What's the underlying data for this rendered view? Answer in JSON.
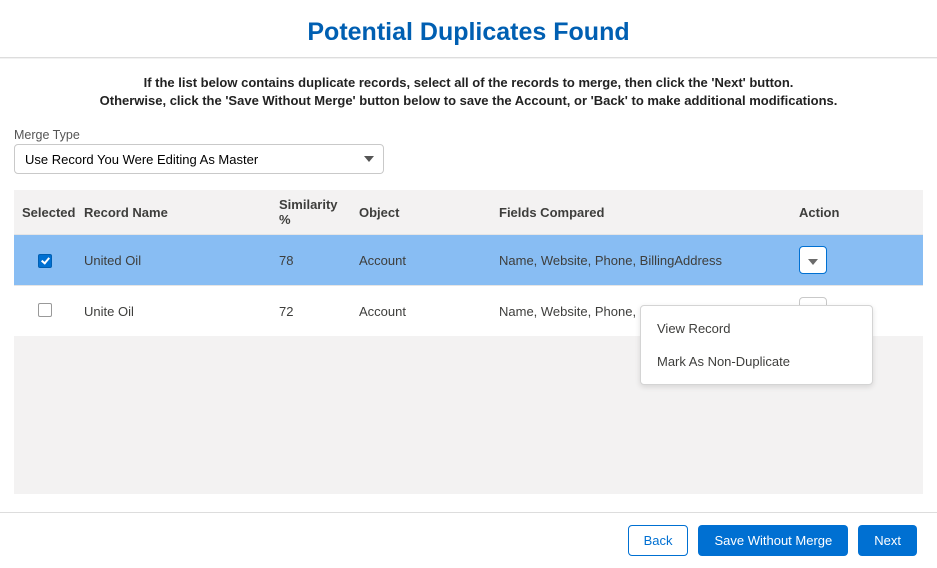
{
  "header": {
    "title": "Potential Duplicates Found"
  },
  "instructions": {
    "line1": "If the list below contains duplicate records, select all of the records to merge, then click the 'Next' button.",
    "line2": "Otherwise, click the 'Save Without Merge' button below to save the Account, or 'Back' to make additional modifications."
  },
  "merge_type": {
    "label": "Merge Type",
    "selected": "Use Record You Were Editing As Master"
  },
  "columns": {
    "selected": "Selected",
    "record_name": "Record Name",
    "similarity": "Similarity %",
    "object": "Object",
    "fields_compared": "Fields Compared",
    "action": "Action"
  },
  "rows": [
    {
      "selected": true,
      "name": "United Oil",
      "similarity": "78",
      "object": "Account",
      "fields": "Name, Website, Phone, BillingAddress"
    },
    {
      "selected": false,
      "name": "Unite Oil",
      "similarity": "72",
      "object": "Account",
      "fields": "Name, Website, Phone, BillingAddress"
    }
  ],
  "action_menu": {
    "view_record": "View Record",
    "mark_non_duplicate": "Mark As Non-Duplicate"
  },
  "footer": {
    "back": "Back",
    "save_without_merge": "Save Without Merge",
    "next": "Next"
  }
}
